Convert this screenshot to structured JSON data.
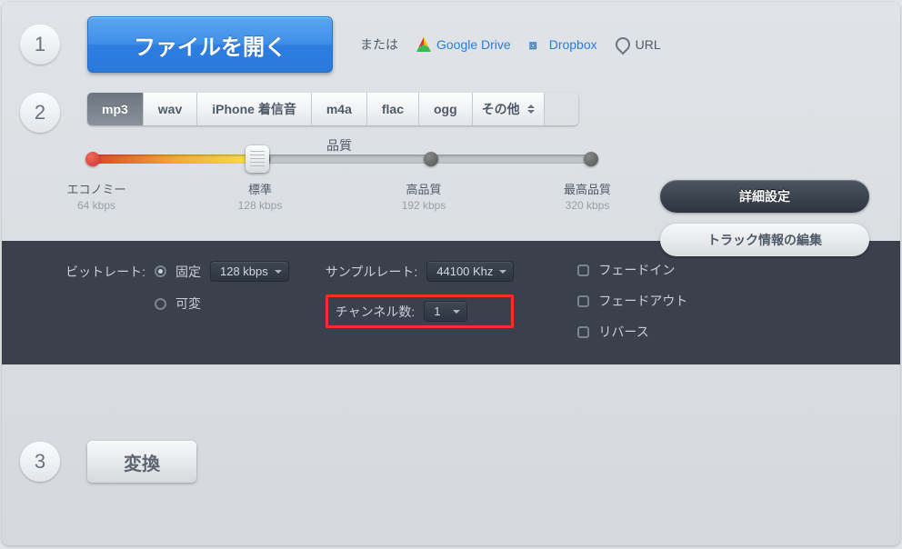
{
  "section1": {
    "open_label": "ファイルを開く",
    "or_label": "または",
    "gdrive": "Google Drive",
    "dropbox": "Dropbox",
    "url": "URL"
  },
  "tabs": {
    "mp3": "mp3",
    "wav": "wav",
    "iphone": "iPhone 着信音",
    "m4a": "m4a",
    "flac": "flac",
    "ogg": "ogg",
    "other": "その他"
  },
  "quality": {
    "title": "品質",
    "economy": "エコノミー",
    "economy_br": "64 kbps",
    "standard": "標準",
    "standard_br": "128 kbps",
    "high": "高品質",
    "high_br": "192 kbps",
    "best": "最高品質",
    "best_br": "320 kbps"
  },
  "side": {
    "advanced": "詳細設定",
    "trackinfo": "トラック情報の編集"
  },
  "adv": {
    "bitrate_label": "ビットレート:",
    "fixed": "固定",
    "variable": "可変",
    "bitrate_value": "128 kbps",
    "samplerate_label": "サンプルレート:",
    "samplerate_value": "44100 Khz",
    "channels_label": "チャンネル数:",
    "channels_value": "1",
    "fadein": "フェードイン",
    "fadeout": "フェードアウト",
    "reverse": "リバース"
  },
  "section3": {
    "convert": "変換"
  }
}
